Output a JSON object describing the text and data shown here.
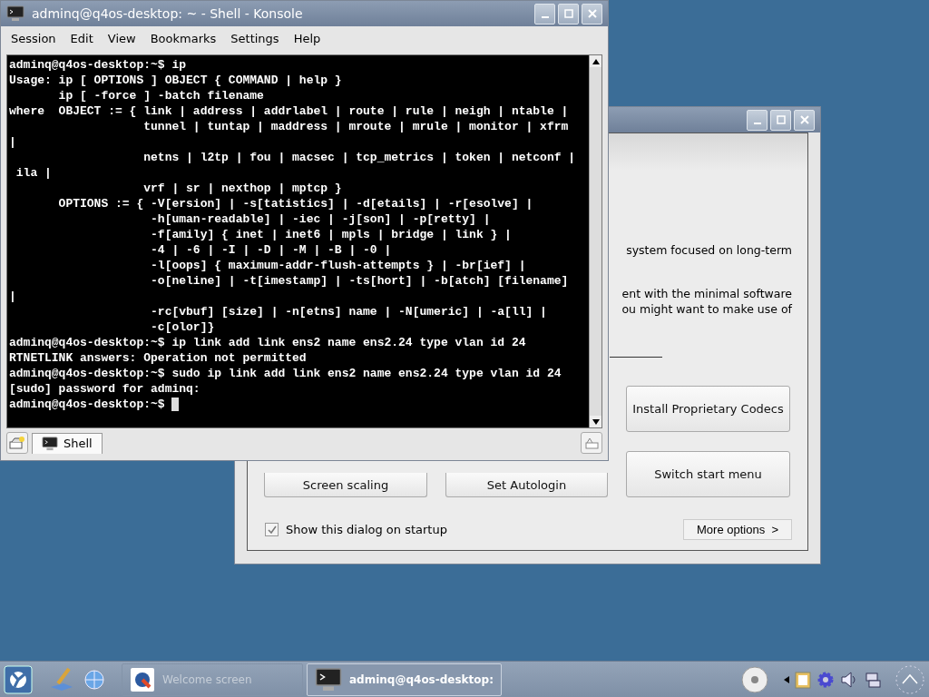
{
  "konsole": {
    "title": "adminq@q4os-desktop: ~ - Shell - Konsole",
    "menu": [
      "Session",
      "Edit",
      "View",
      "Bookmarks",
      "Settings",
      "Help"
    ],
    "lines": [
      "adminq@q4os-desktop:~$ ip",
      "Usage: ip [ OPTIONS ] OBJECT { COMMAND | help }",
      "       ip [ -force ] -batch filename",
      "where  OBJECT := { link | address | addrlabel | route | rule | neigh | ntable |",
      "                   tunnel | tuntap | maddress | mroute | mrule | monitor | xfrm",
      "|",
      "                   netns | l2tp | fou | macsec | tcp_metrics | token | netconf |",
      " ila |",
      "                   vrf | sr | nexthop | mptcp }",
      "       OPTIONS := { -V[ersion] | -s[tatistics] | -d[etails] | -r[esolve] |",
      "                    -h[uman-readable] | -iec | -j[son] | -p[retty] |",
      "                    -f[amily] { inet | inet6 | mpls | bridge | link } |",
      "                    -4 | -6 | -I | -D | -M | -B | -0 |",
      "                    -l[oops] { maximum-addr-flush-attempts } | -br[ief] |",
      "                    -o[neline] | -t[imestamp] | -ts[hort] | -b[atch] [filename]",
      "|",
      "                    -rc[vbuf] [size] | -n[etns] name | -N[umeric] | -a[ll] |",
      "                    -c[olor]}",
      "adminq@q4os-desktop:~$ ip link add link ens2 name ens2.24 type vlan id 24",
      "RTNETLINK answers: Operation not permitted",
      "adminq@q4os-desktop:~$ sudo ip link add link ens2 name ens2.24 type vlan id 24",
      "[sudo] password for adminq:",
      "adminq@q4os-desktop:~$ "
    ],
    "tabs": [
      {
        "label": "Shell",
        "selected": true
      }
    ]
  },
  "welcome": {
    "fragments": [
      "system focused on long-term",
      "ent with the minimal software",
      "ou might want to make use of"
    ],
    "buttons": [
      {
        "label": "Install Proprietary Codecs"
      },
      {
        "label": "Screen scaling"
      },
      {
        "label": "Set Autologin"
      },
      {
        "label": "Switch start menu"
      }
    ],
    "show_on_startup": {
      "label": "Show this dialog on startup",
      "checked": true
    },
    "more_button": "More options  >"
  },
  "taskbar": {
    "tasks": [
      {
        "label": "Welcome screen",
        "selected": false
      },
      {
        "label": "adminq@q4os-desktop:",
        "selected": true
      }
    ]
  }
}
